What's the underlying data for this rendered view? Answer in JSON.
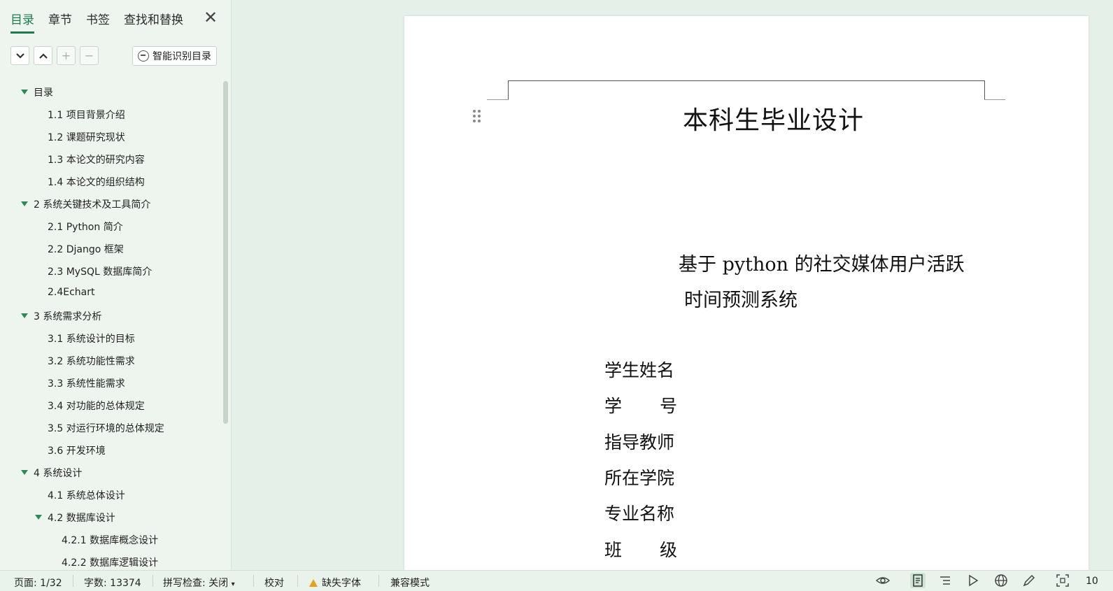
{
  "sidebar": {
    "tabs": [
      {
        "label": "目录",
        "active": true
      },
      {
        "label": "章节",
        "active": false
      },
      {
        "label": "书签",
        "active": false
      },
      {
        "label": "查找和替换",
        "active": false
      }
    ],
    "close_icon": "close-icon",
    "toolbar": {
      "expand_icon": "chevron-down-icon",
      "collapse_icon": "chevron-up-icon",
      "add_icon": "plus-icon",
      "remove_icon": "minus-icon",
      "smart_label": "智能识别目录"
    },
    "toc": [
      {
        "label": "目录",
        "level": 1,
        "caret": true
      },
      {
        "label": "1.1 项目背景介绍",
        "level": 2
      },
      {
        "label": "1.2 课题研究现状",
        "level": 2
      },
      {
        "label": "1.3 本论文的研究内容",
        "level": 2
      },
      {
        "label": "1.4 本论文的组织结构",
        "level": 2
      },
      {
        "label": "2 系统关键技术及工具简介",
        "level": 1,
        "caret": true
      },
      {
        "label": "2.1 Python 简介",
        "level": 2
      },
      {
        "label": "2.2 Django 框架",
        "level": 2
      },
      {
        "label": "2.3 MySQL 数据库简介",
        "level": 2
      },
      {
        "label": "2.4Echart",
        "level": 2
      },
      {
        "label": "3 系统需求分析",
        "level": 1,
        "caret": true
      },
      {
        "label": "3.1 系统设计的目标",
        "level": 2
      },
      {
        "label": "3.2 系统功能性需求",
        "level": 2
      },
      {
        "label": "3.3 系统性能需求",
        "level": 2
      },
      {
        "label": "3.4 对功能的总体规定",
        "level": 2
      },
      {
        "label": "3.5 对运行环境的总体规定",
        "level": 2
      },
      {
        "label": "3.6 开发环境",
        "level": 2
      },
      {
        "label": "4 系统设计",
        "level": 1,
        "caret": true
      },
      {
        "label": "4.1 系统总体设计",
        "level": 2
      },
      {
        "label": "4.2 数据库设计",
        "level": 2,
        "caret": true
      },
      {
        "label": "4.2.1  数据库概念设计",
        "level": 3
      },
      {
        "label": "4.2.2  数据库逻辑设计",
        "level": 3
      }
    ]
  },
  "document": {
    "title": "本科生毕业设计",
    "subtitle_line1": "基于 python 的社交媒体用户活跃",
    "subtitle_line2": "时间预测系统",
    "fields": [
      {
        "label": "学生姓名"
      },
      {
        "chars": [
          "学",
          "号"
        ]
      },
      {
        "label": "指导教师"
      },
      {
        "label": "所在学院"
      },
      {
        "label": "专业名称"
      },
      {
        "chars": [
          "班",
          "级"
        ]
      }
    ]
  },
  "status": {
    "page": "页面: 1/32",
    "words": "字数: 13374",
    "spell": "拼写检查: 关闭",
    "proofread": "校对",
    "missing_font": "缺失字体",
    "compat": "兼容模式",
    "zoom_partial": "10",
    "icons": [
      "eye-icon",
      "page-view-icon",
      "outline-view-icon",
      "play-icon",
      "web-view-icon",
      "pen-icon",
      "fit-screen-icon"
    ]
  }
}
